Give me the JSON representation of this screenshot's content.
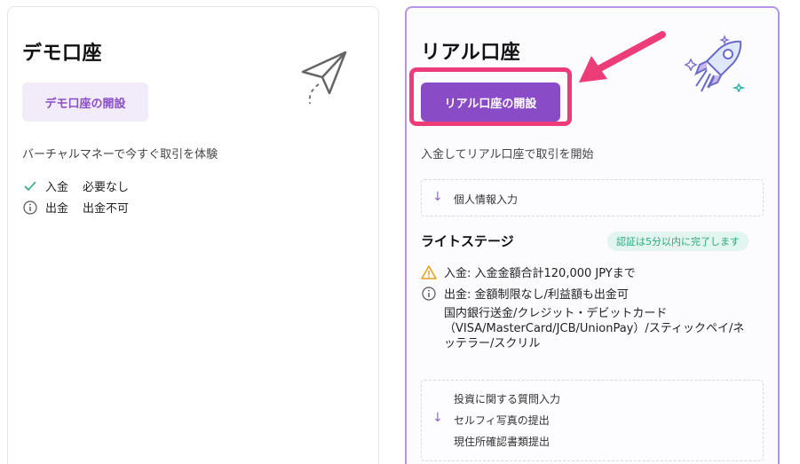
{
  "demo": {
    "title": "デモ口座",
    "button_label": "デモ口座の開設",
    "description": "バーチャルマネーで今すぐ取引を体験",
    "features": [
      {
        "icon": "check-icon",
        "label": "入金",
        "value": "必要なし"
      },
      {
        "icon": "info-icon",
        "label": "出金",
        "value": "出金不可"
      }
    ]
  },
  "real": {
    "title": "リアル口座",
    "button_label": "リアル口座の開設",
    "description": "入金してリアル口座で取引を開始",
    "step1": "個人情報入力",
    "stage": {
      "title": "ライトステージ",
      "badge": "認証は5分以内に完了します",
      "deposit": "入金: 入金金額合計120,000 JPYまで",
      "withdraw": "出金: 金額制限なし/利益額も出金可",
      "methods": "国内銀行送金/クレジット・デビットカード（VISA/MasterCard/JCB/UnionPay）/スティックペイ/ネッテラー/スクリル"
    },
    "step2_items": [
      "投資に関する質問入力",
      "セルフィ写真の提出",
      "現住所確認書類提出"
    ]
  },
  "colors": {
    "accent": "#8a4bc6",
    "highlight": "#ec3d78",
    "badge_green": "#2ea682",
    "warning": "#e0a020"
  }
}
